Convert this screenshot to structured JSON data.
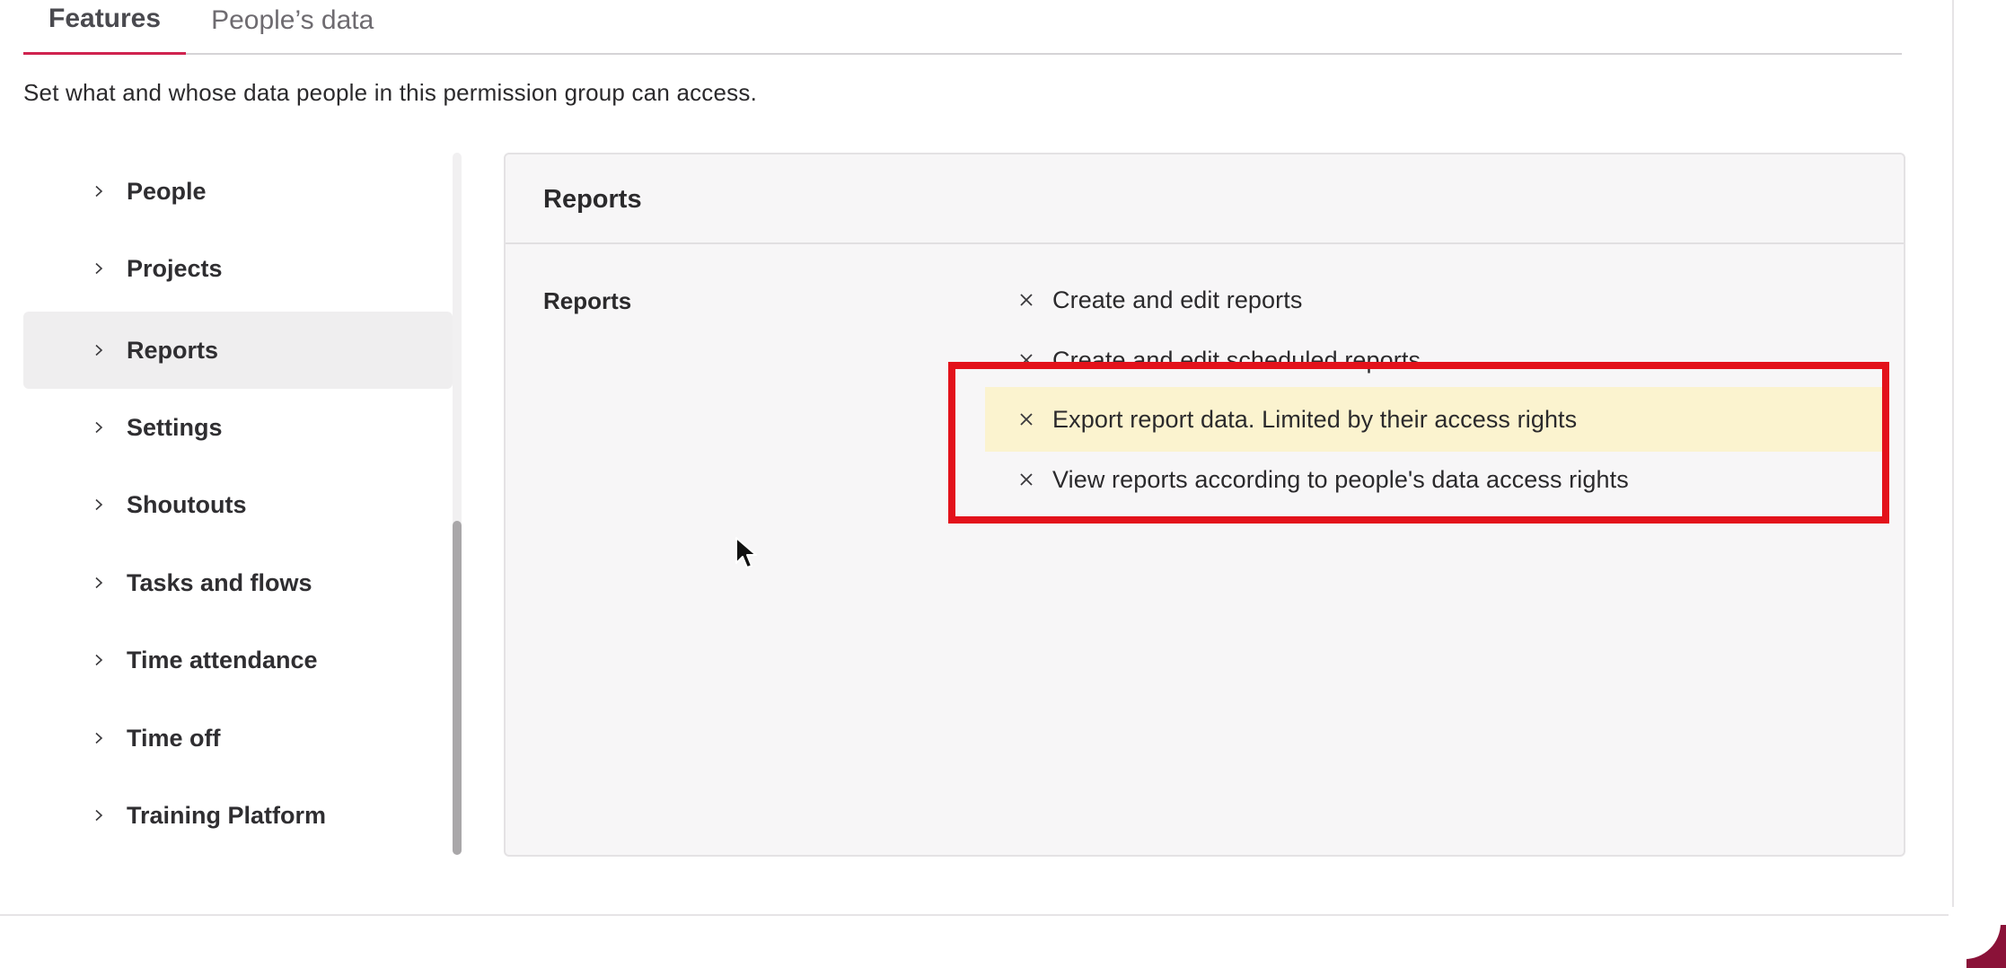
{
  "tabs": [
    {
      "label": "Features",
      "active": true
    },
    {
      "label": "People’s data",
      "active": false
    }
  ],
  "description": "Set what and whose data people in this permission group can access.",
  "sidebar": {
    "items": [
      {
        "label": "People",
        "icon": "chevron-right-icon",
        "selected": false
      },
      {
        "label": "Projects",
        "icon": "chevron-right-icon",
        "selected": false
      },
      {
        "label": "Reports",
        "icon": "chevron-right-icon",
        "selected": true
      },
      {
        "label": "Settings",
        "icon": "chevron-right-icon",
        "selected": false
      },
      {
        "label": "Shoutouts",
        "icon": "chevron-right-icon",
        "selected": false
      },
      {
        "label": "Tasks and flows",
        "icon": "chevron-right-icon",
        "selected": false
      },
      {
        "label": "Time attendance",
        "icon": "chevron-right-icon",
        "selected": false
      },
      {
        "label": "Time off",
        "icon": "chevron-right-icon",
        "selected": false
      },
      {
        "label": "Training Platform",
        "icon": "chevron-right-icon",
        "selected": false
      }
    ]
  },
  "panel": {
    "title": "Reports",
    "section_label": "Reports",
    "permissions": [
      {
        "label": "Create and edit reports",
        "icon": "x-icon",
        "highlighted": false
      },
      {
        "label": "Create and edit scheduled reports",
        "icon": "x-icon",
        "highlighted": false
      },
      {
        "label": "Export report data. Limited by their access rights",
        "icon": "x-icon",
        "highlighted": true
      },
      {
        "label": "View reports according to people's data access rights",
        "icon": "x-icon",
        "highlighted": false
      }
    ]
  },
  "colors": {
    "tab_active_underline": "#d0234f",
    "highlight_row": "#fbf3cf",
    "annotation_box": "#e3121b",
    "selected_item_bg": "#efeeef",
    "panel_bg": "#f7f6f7"
  }
}
